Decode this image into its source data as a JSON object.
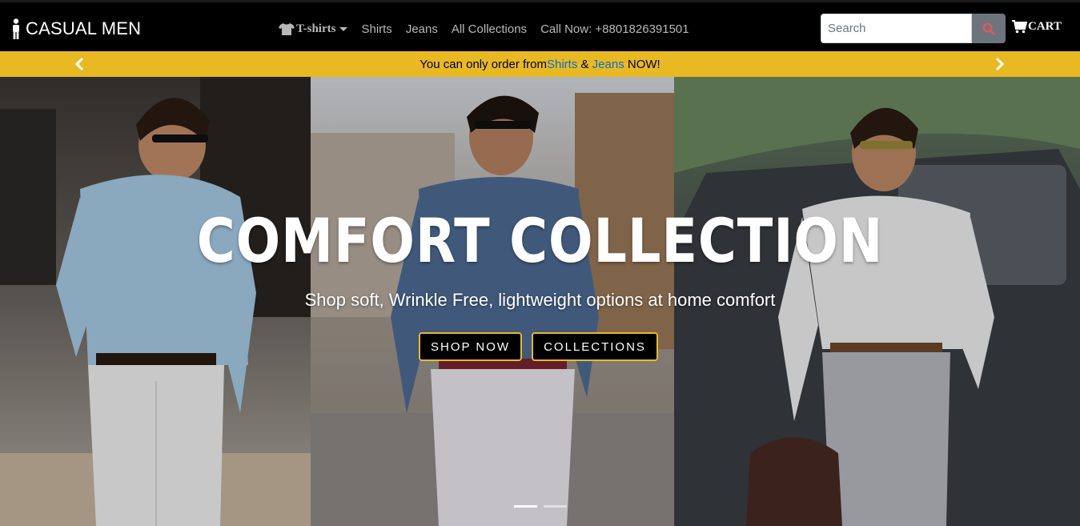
{
  "brand": {
    "name": "CASUAL MEN",
    "icon": "person-icon"
  },
  "nav": {
    "items": [
      {
        "label": "T-shirts",
        "icon": "tshirt-icon",
        "dropdown": true
      },
      {
        "label": "Shirts"
      },
      {
        "label": "Jeans"
      },
      {
        "label": "All Collections"
      },
      {
        "label": "Call Now: +8801826391501"
      }
    ]
  },
  "search": {
    "placeholder": "Search",
    "value": "",
    "button_icon": "search-icon"
  },
  "cart": {
    "label": "CART",
    "icon": "cart-icon"
  },
  "notice": {
    "prefix": "You can only order from ",
    "link1": "Shirts",
    "mid": " & ",
    "link2": "Jeans",
    "suffix": " NOW!",
    "bg_color": "#e8b923",
    "link_color": "#0a6ed1"
  },
  "hero": {
    "title": "COMFORT COLLECTION",
    "subtitle": "Shop soft, Wrinkle Free, lightweight options at home comfort",
    "buttons": [
      {
        "label": "SHOP NOW"
      },
      {
        "label": "COLLECTIONS"
      }
    ],
    "button_border_color": "#e8b923",
    "slides": 2,
    "active_slide": 1
  }
}
